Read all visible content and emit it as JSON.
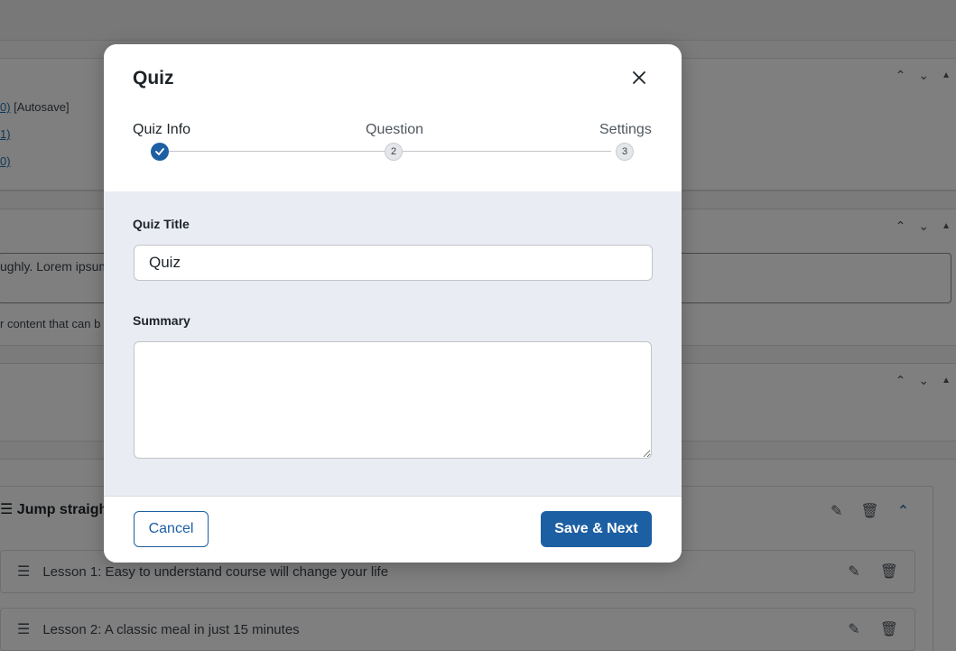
{
  "background": {
    "revisions": [
      {
        "link": "0)",
        "suffix": " [Autosave]"
      },
      {
        "link": "1)",
        "suffix": ""
      },
      {
        "link": "0)",
        "suffix": ""
      }
    ],
    "excerpt_text": "ughly. Lorem ipsum",
    "excerpt_hint": "r content that can b",
    "topic_title": "Jump straigh",
    "lessons": [
      {
        "title": "Lesson 1: Easy to understand course will change your life"
      },
      {
        "title": "Lesson 2: A classic meal in just 15 minutes"
      }
    ]
  },
  "modal": {
    "title": "Quiz",
    "steps": [
      {
        "label": "Quiz Info",
        "state": "done"
      },
      {
        "label": "Question",
        "number": "2",
        "state": "pending"
      },
      {
        "label": "Settings",
        "number": "3",
        "state": "pending"
      }
    ],
    "quiz_title_label": "Quiz Title",
    "quiz_title_value": "Quiz",
    "summary_label": "Summary",
    "summary_value": "",
    "cancel_label": "Cancel",
    "save_label": "Save & Next"
  },
  "colors": {
    "primary": "#1d5fa3",
    "body_bg": "#eaecf4"
  }
}
